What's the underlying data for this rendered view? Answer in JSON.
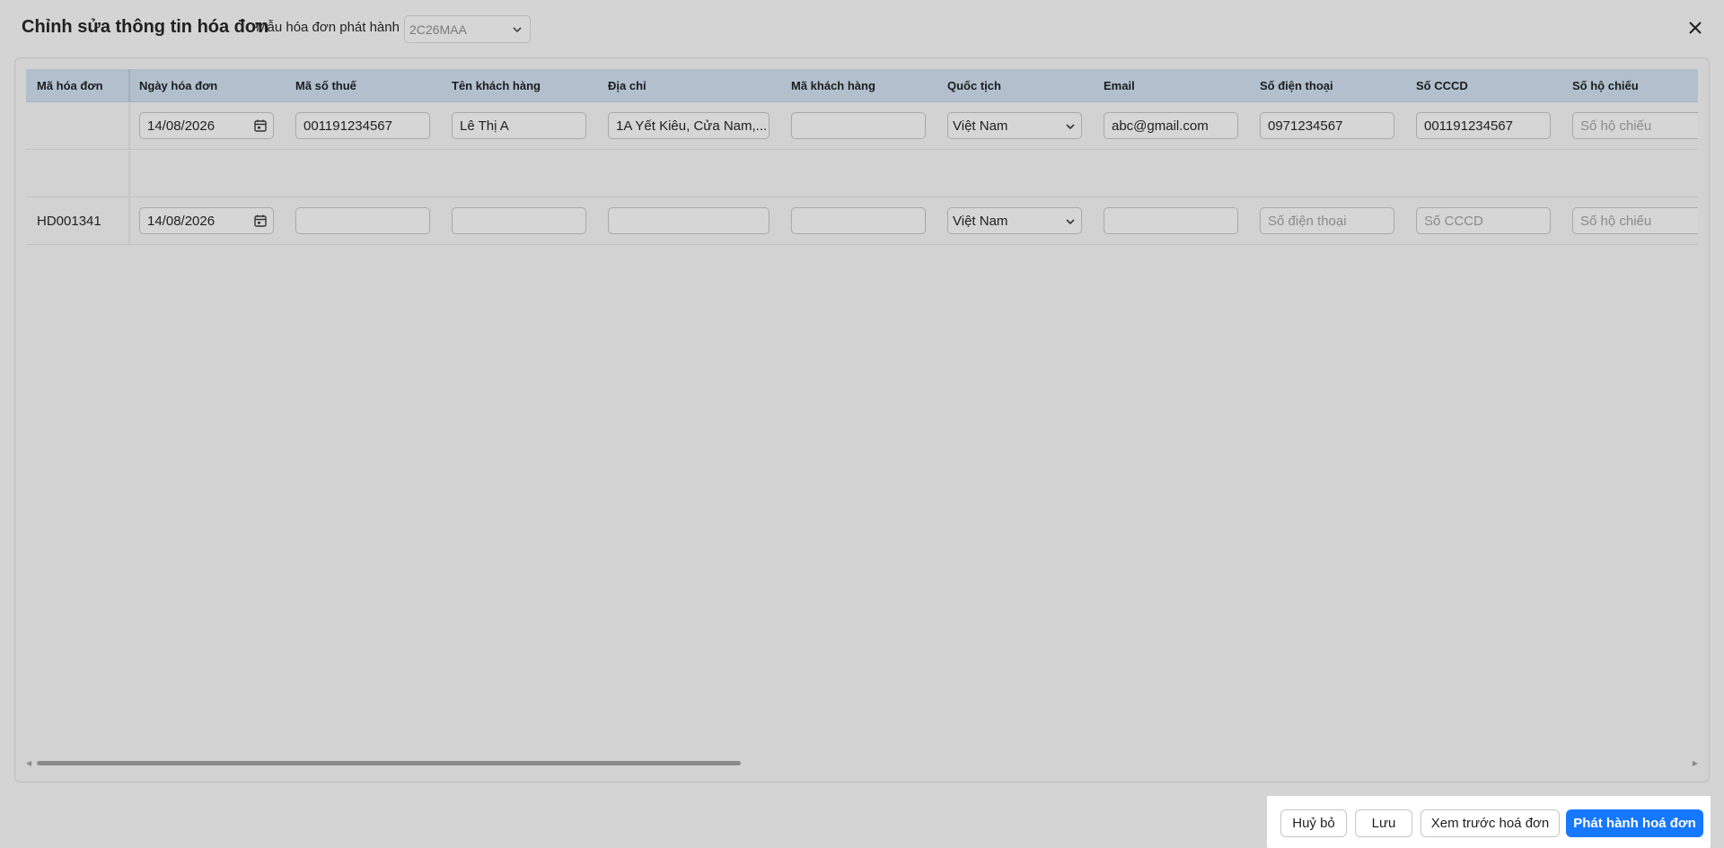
{
  "dialog": {
    "title": "Chỉnh sửa thông tin hóa đơn",
    "template_label": "Mẫu hóa đơn phát hành",
    "template_value": "2C26MAA"
  },
  "table": {
    "columns": [
      "Mã hóa đơn",
      "Ngày hóa đơn",
      "Mã số thuế",
      "Tên khách hàng",
      "Địa chỉ",
      "Mã khách hàng",
      "Quốc tịch",
      "Email",
      "Số điện thoại",
      "Số CCCD",
      "Số hộ chiếu"
    ],
    "rows": [
      {
        "invoice_code": "",
        "date": "14/08/2026",
        "tax_code": "001191234567",
        "customer_name": "Lê Thị A",
        "address": "1A Yết Kiêu, Cửa Nam,...",
        "customer_code": "",
        "nationality": "Việt Nam",
        "email": "abc@gmail.com",
        "phone": "0971234567",
        "cccd": "001191234567",
        "passport": "",
        "passport_placeholder": "Số hộ chiếu"
      },
      {
        "invoice_code": "HD001341",
        "date": "14/08/2026",
        "tax_code": "",
        "customer_name": "",
        "address": "",
        "customer_code": "",
        "nationality": "Việt Nam",
        "email": "",
        "phone": "",
        "phone_placeholder": "Số điện thoại",
        "cccd": "",
        "cccd_placeholder": "Số CCCD",
        "passport": "",
        "passport_placeholder": "Số hộ chiếu"
      }
    ]
  },
  "footer": {
    "cancel": "Huỷ bỏ",
    "save": "Lưu",
    "preview": "Xem trước hoá đơn",
    "issue": "Phát hành hoá đơn"
  },
  "colors": {
    "primary": "#1677ff",
    "header_bg": "#b2c0ce",
    "overlay_bg": "#d4d4d4"
  }
}
